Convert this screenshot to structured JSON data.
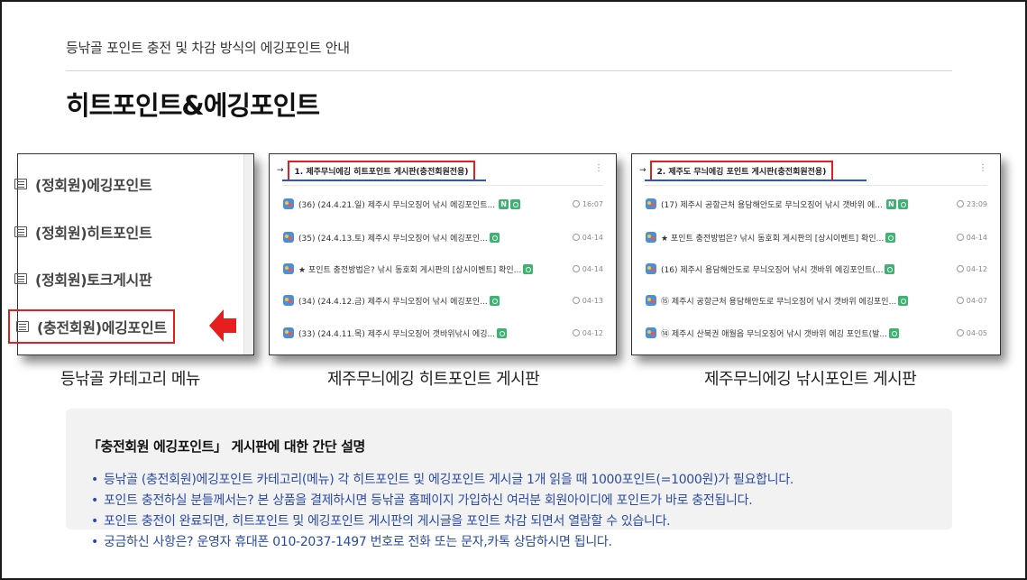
{
  "header": {
    "subtitle": "등낚골 포인트 충전 및 차감 방식의 에깅포인트 안내",
    "title": "히트포인트&에깅포인트"
  },
  "category_menu": {
    "items": [
      {
        "label": "(정회원)에깅포인트"
      },
      {
        "label": "(정회원)히트포인트"
      },
      {
        "label": "(정회원)토크게시판"
      },
      {
        "label": "(충전회원)에깅포인트"
      }
    ],
    "caption": "등낚골 카테고리 메뉴"
  },
  "board1": {
    "arrow": "→",
    "title": "1. 제주무늬에깅 히트포인트 게시판(충전회원전용)",
    "caption": "제주무늬에깅 히트포인트 게시판",
    "posts": [
      {
        "text": "(36) (24.4.21.일) 제주시 무늬오징어 낚시 에깅포인트...",
        "new": "N",
        "date": "16:07"
      },
      {
        "text": "(35) (24.4.13.토) 제주시 무늬오징어 낚시 에깅포인...",
        "new": "",
        "date": "04-14"
      },
      {
        "text": "★ 포인트 충전방법은? 낚시 동호회 게시판의 [상시이벤트] 확인...",
        "new": "",
        "date": "04-14"
      },
      {
        "text": "(34) (24.4.12.금) 제주시 무늬오징어 낚시 에깅포인...",
        "new": "",
        "date": "04-13"
      },
      {
        "text": "(33) (24.4.11.목) 제주시 무늬오징어 갯바위낚시 에깅...",
        "new": "",
        "date": "04-12"
      }
    ]
  },
  "board2": {
    "arrow": "→",
    "title": "2. 제주도 무늬에깅 포인트 게시판(충전회원전용)",
    "caption": "제주무늬에깅 낚시포인트 게시판",
    "posts": [
      {
        "text": "(17) 제주시 공항근처 용담해안도로 무늬오징어 낚시 갯바위 에...",
        "new": "N",
        "date": "23:09"
      },
      {
        "text": "★ 포인트 충전방법은? 낚시 동호회 게시판의 [상시이벤트] 확인...",
        "new": "",
        "date": "04-14"
      },
      {
        "text": "(16) 제주시 용담해안도로 무늬오징어 낚시 갯바위 에깅포인트(...",
        "new": "",
        "date": "04-12"
      },
      {
        "text": "⑮ 제주시 공항근처 용담해안도로 무늬오징어 낚시 갯바위 에깅포인...",
        "new": "",
        "date": "04-07"
      },
      {
        "text": "⑭ 제주시 산북권 애월읍 무늬오징어 낚시 갯바위 에깅 포인트(발...",
        "new": "",
        "date": "04-05"
      }
    ]
  },
  "description": {
    "title": "「충전회원 에깅포인트」 게시판에 대한 간단 설명",
    "items": [
      "등낚골 (충전회원)에깅포인트 카테고리(메뉴) 각 히트포인트 및 에깅포인트 게시글 1개 읽을 때 1000포인트(=1000원)가 필요합니다.",
      "포인트 충전하실 분들께서는? 본 상품을 결제하시면 등낚골 홈페이지 가입하신 여러분 회원아이디에 포인트가 바로 충전됩니다.",
      "포인트 충전이 완료되면, 히트포인트 및 에깅포인트 게시판의 게시글을 포인트 차감 되면서 열람할 수 있습니다.",
      "궁금하신 사항은? 운영자 휴대폰 010-2037-1497 번호로 전화 또는 문자,카톡 상담하시면 됩니다."
    ]
  },
  "colors": {
    "highlight_red": "#e02020",
    "link_blue": "#2a4aa8",
    "badge_green": "#3cb371"
  }
}
